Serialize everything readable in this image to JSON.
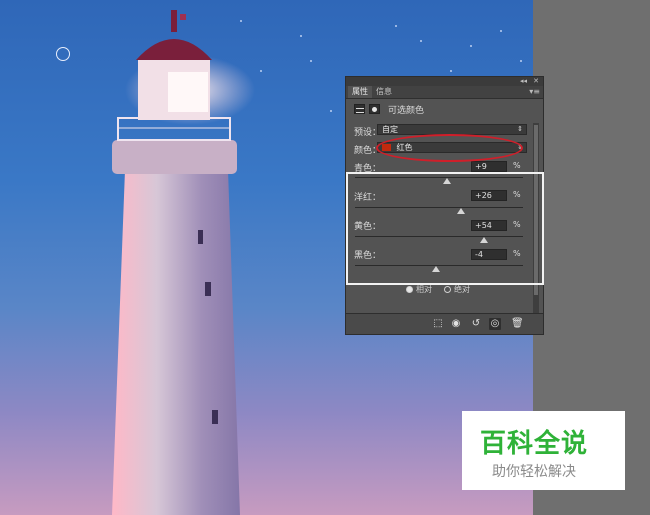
{
  "panel": {
    "tabs": [
      {
        "label": "属性",
        "active": true
      },
      {
        "label": "信息",
        "active": false
      }
    ],
    "window_controls": {
      "collapse": "◂◂",
      "close": "✕"
    },
    "menu_icon": "menu-lines-icon",
    "title": "可选颜色",
    "preset": {
      "label": "预设：",
      "value": "自定"
    },
    "colors": {
      "label": "颜色：",
      "value": "红色",
      "swatch": "#c2290e"
    },
    "sliders": [
      {
        "name": "cyan",
        "label": "青色：",
        "value": "+9",
        "unit": "%",
        "level": 0.55
      },
      {
        "name": "magenta",
        "label": "洋红：",
        "value": "+26",
        "unit": "%",
        "level": 0.63
      },
      {
        "name": "yellow",
        "label": "黄色：",
        "value": "+54",
        "unit": "%",
        "level": 0.77
      },
      {
        "name": "black",
        "label": "黑色：",
        "value": "-4",
        "unit": "%",
        "level": 0.48
      }
    ],
    "method": {
      "relative": {
        "label": "相对",
        "selected": true
      },
      "absolute": {
        "label": "绝对",
        "selected": false
      }
    },
    "bottom_icons": [
      "clip-to-layer-icon",
      "view-previous-icon",
      "reset-icon",
      "visibility-eye-icon",
      "trash-icon"
    ]
  },
  "watermark": {
    "title": "百科全说",
    "subtitle": "助你轻松解决",
    "title_color": "#2fb238"
  },
  "annotation_colors": {
    "ellipse": "#d01f2a",
    "rect": "#f2f2f2"
  }
}
